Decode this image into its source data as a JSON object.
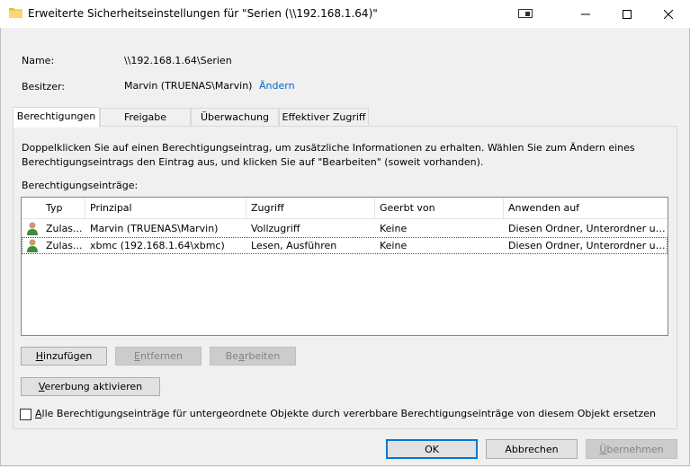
{
  "window": {
    "title": "Erweiterte Sicherheitseinstellungen für \"Serien (\\\\192.168.1.64)\""
  },
  "info": {
    "name_label": "Name:",
    "name_value": "\\\\192.168.1.64\\Serien",
    "owner_label": "Besitzer:",
    "owner_value": "Marvin (TRUENAS\\Marvin)",
    "change_link": "Ändern"
  },
  "tabs": [
    {
      "label": "Berechtigungen",
      "active": true
    },
    {
      "label": "Freigabe"
    },
    {
      "label": "Überwachung"
    },
    {
      "label": "Effektiver Zugriff"
    }
  ],
  "panel": {
    "description": "Doppelklicken Sie auf einen Berechtigungseintrag, um zusätzliche Informationen zu erhalten. Wählen Sie zum Ändern eines Berechtigungseintrags den Eintrag aus, und klicken Sie auf \"Bearbeiten\" (soweit vorhanden).",
    "list_label": "Berechtigungseinträge:"
  },
  "table": {
    "columns": [
      "Typ",
      "Prinzipal",
      "Zugriff",
      "Geerbt von",
      "Anwenden auf"
    ],
    "rows": [
      {
        "type": "Zulas...",
        "principal": "Marvin (TRUENAS\\Marvin)",
        "access": "Vollzugriff",
        "inherited": "Keine",
        "applies": "Diesen Ordner, Unterordner un..."
      },
      {
        "type": "Zulas...",
        "principal": "xbmc (192.168.1.64\\xbmc)",
        "access": "Lesen, Ausführen",
        "inherited": "Keine",
        "applies": "Diesen Ordner, Unterordner un..."
      }
    ]
  },
  "buttons": {
    "add": {
      "pre": "",
      "key": "H",
      "post": "inzufügen"
    },
    "remove": {
      "pre": "",
      "key": "E",
      "post": "ntfernen"
    },
    "edit": {
      "pre": "Be",
      "key": "a",
      "post": "rbeiten"
    },
    "enable_inheritance": {
      "pre": "",
      "key": "V",
      "post": "ererbung aktivieren"
    },
    "ok": "OK",
    "cancel": "Abbrechen",
    "apply": {
      "pre": "",
      "key": "Ü",
      "post": "bernehmen"
    }
  },
  "replace_checkbox": {
    "key": "A",
    "post": "lle Berechtigungseinträge für untergeordnete Objekte durch vererbbare Berechtigungseinträge von diesem Objekt ersetzen",
    "checked": false
  },
  "colors": {
    "link": "#0066cc",
    "default_button_border": "#0078d7"
  }
}
